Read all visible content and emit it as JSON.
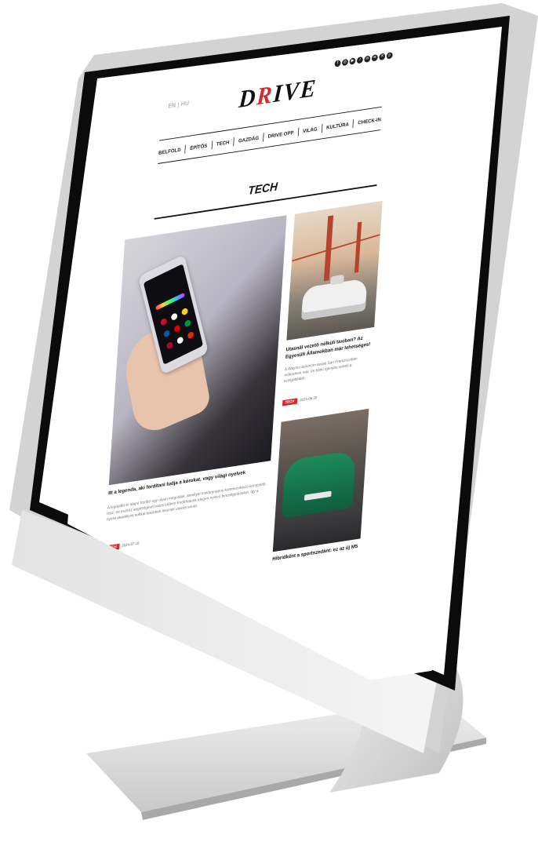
{
  "header": {
    "lang": "EN | HU",
    "logo_pre": "D",
    "logo_accent": "R",
    "logo_post": "IVE",
    "social_icons": [
      "facebook-icon",
      "instagram-icon",
      "youtube-icon",
      "tiktok-icon",
      "linkedin-icon",
      "spotify-icon",
      "x-icon",
      "pinterest-icon"
    ]
  },
  "nav": {
    "items": [
      {
        "label": "BELFÖLD"
      },
      {
        "label": "ÉPÍTŐS"
      },
      {
        "label": "TECH"
      },
      {
        "label": "GAZDÁG"
      },
      {
        "label": "DRIVE OPP"
      },
      {
        "label": "VILÁG"
      },
      {
        "label": "KULTÚRA"
      },
      {
        "label": "CHECK-IN"
      }
    ]
  },
  "section": {
    "title": "TECH"
  },
  "main_article": {
    "title": "Itt a legenda, aki fordítani tudja a kórokat, vagy világi nyelvek",
    "excerpt": "A legújabb AI alapú fordító egy olyan megoldás, amellyel mindennapos kommunikáció könnyebb lesz. Az eszköz segítségével valós időben fordíthatunk idegen nyelvű beszélgetéseket, így a nyelvi akadályok sokkal kisebbek lesznek utazás során.",
    "tag": "TECH",
    "date": "2024-07-18"
  },
  "side_article_1": {
    "title": "Utasnál vezető nélküli taxiban? Az Egyesült Államokban már lehetséges!",
    "excerpt": "A Waymo autonóm taxijai San Franciscóban működnek már, és bárki igénybe veheti a szolgáltatást.",
    "tag": "TECH",
    "date": "2024-06-20"
  },
  "side_article_2": {
    "title": "Hibridként a sportszedánt: ez az új M5"
  }
}
